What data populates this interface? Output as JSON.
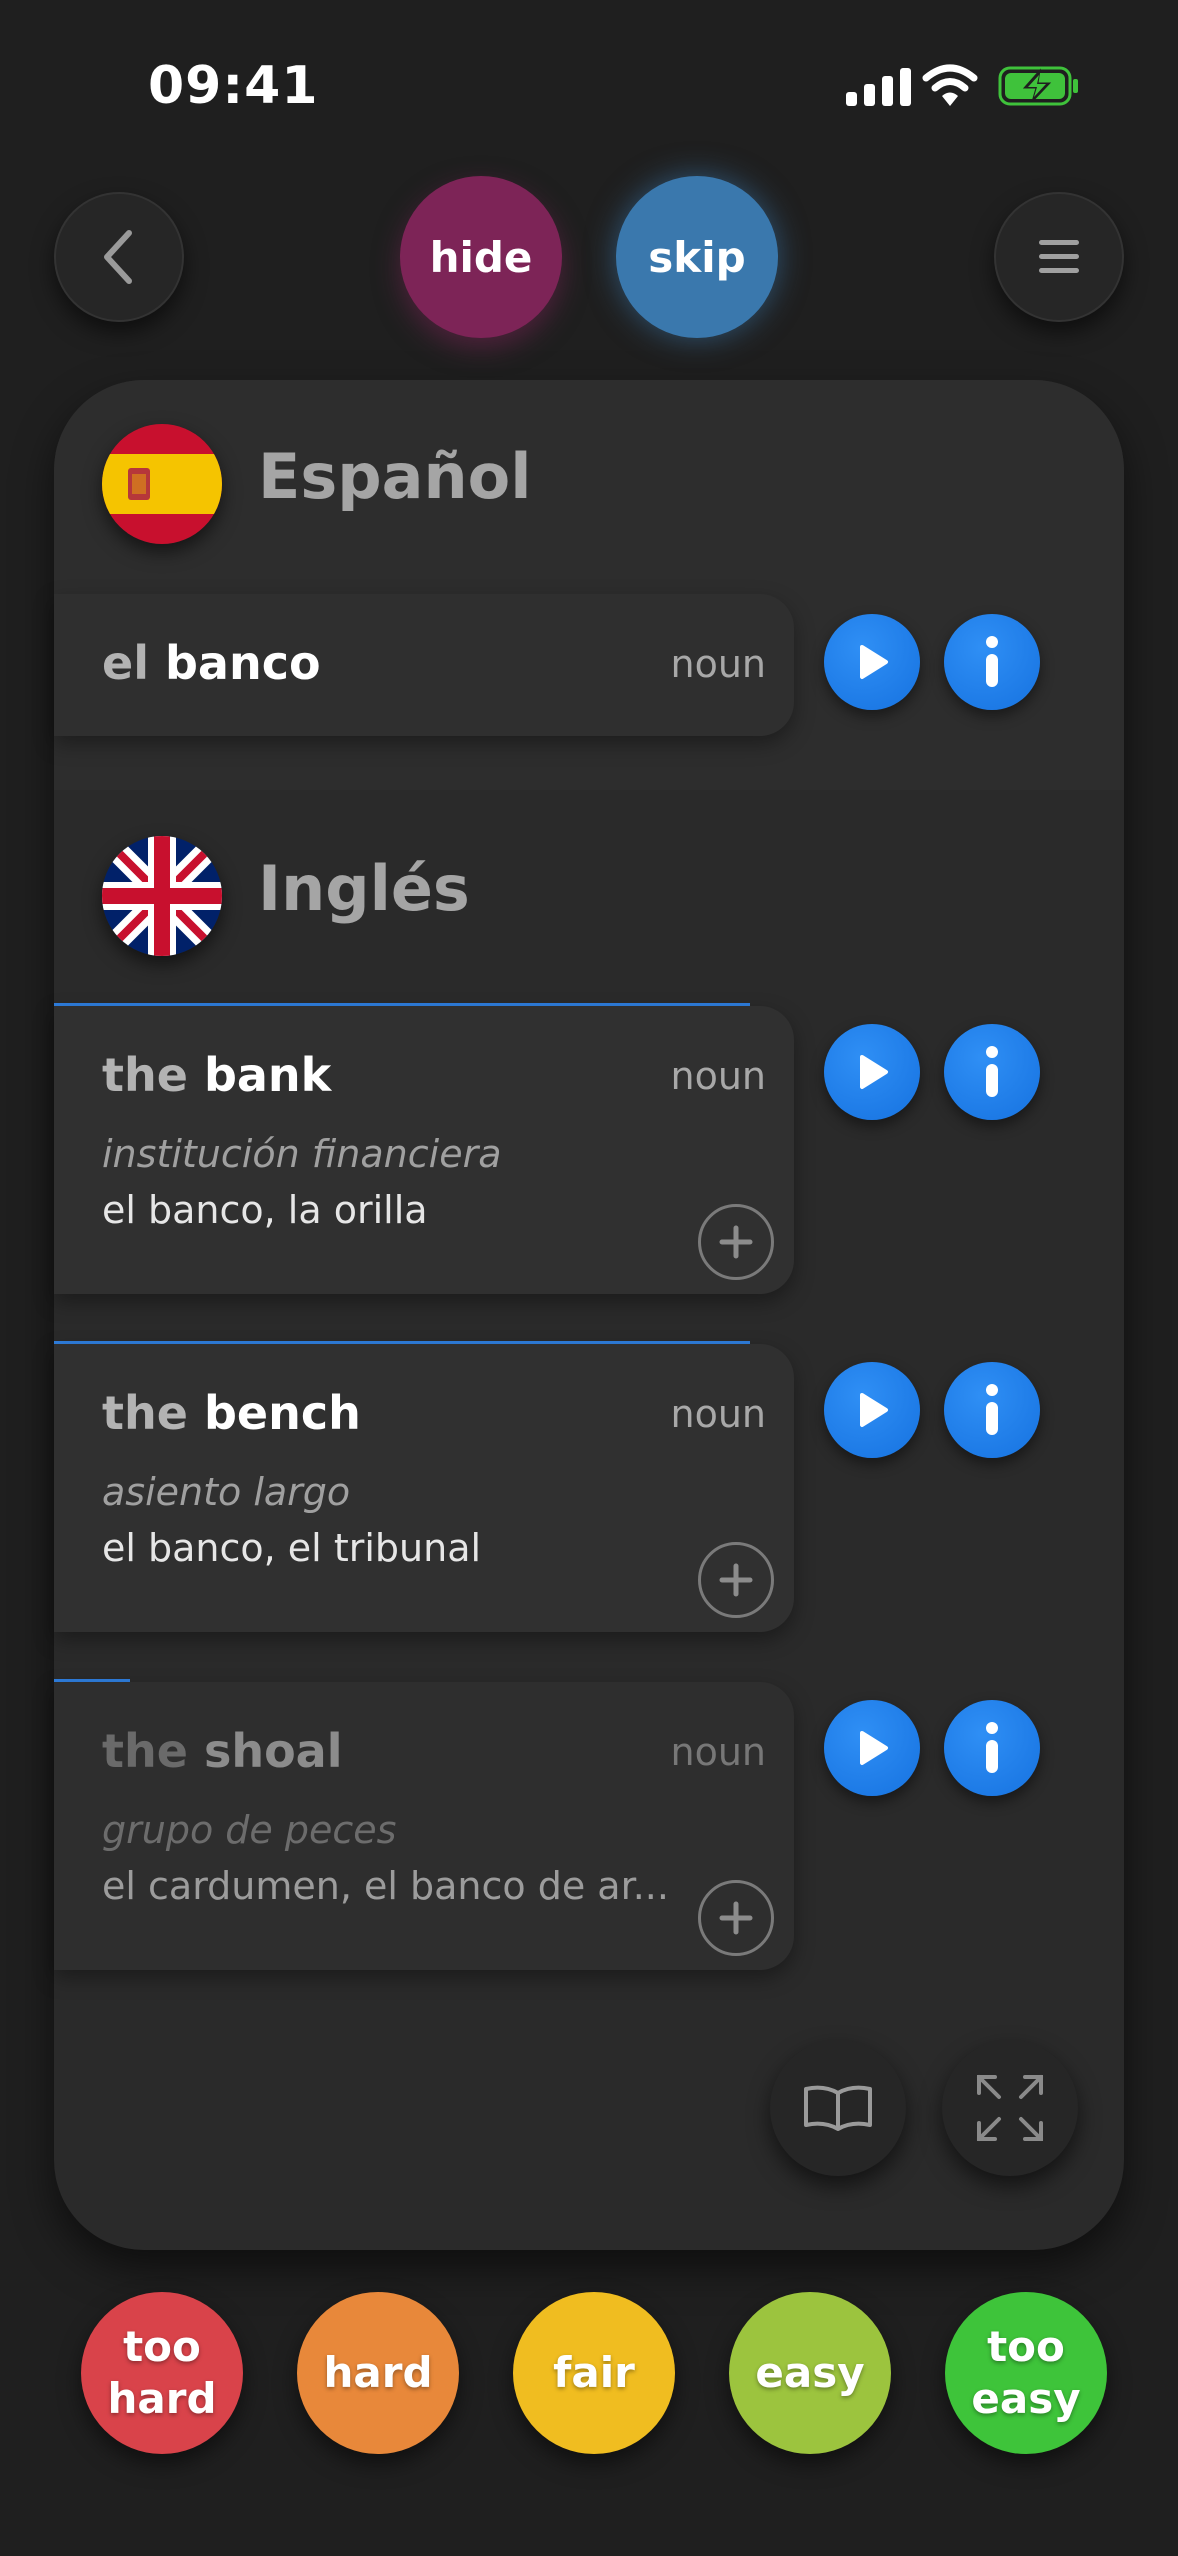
{
  "status_bar": {
    "time": "09:41"
  },
  "top_nav": {
    "back_icon": "chevron-left-icon",
    "hide_label": "hide",
    "skip_label": "skip",
    "menu_icon": "hamburger-menu-icon",
    "hide_color": "#7d2457",
    "skip_color": "#3a78ad"
  },
  "source": {
    "language": "Español",
    "flag": "spain-flag",
    "word": {
      "article": "el",
      "lemma": "banco",
      "pos": "noun"
    }
  },
  "target": {
    "language": "Inglés",
    "flag": "uk-flag",
    "entries": [
      {
        "article": "the",
        "lemma": "bank",
        "pos": "noun",
        "definition": "institución financiera",
        "translations": "el banco, la orilla",
        "progress": 0.85
      },
      {
        "article": "the",
        "lemma": "bench",
        "pos": "noun",
        "definition": "asiento largo",
        "translations": "el banco, el tribunal",
        "progress": 0.85
      },
      {
        "article": "the",
        "lemma": "shoal",
        "pos": "noun",
        "definition": "grupo de peces",
        "translations": "el cardumen, el banco de ar...",
        "progress": 0.1
      }
    ]
  },
  "card_tools": {
    "book_icon": "open-book-icon",
    "expand_icon": "expand-icon"
  },
  "rating": {
    "too_hard_1": "too",
    "too_hard_2": "hard",
    "hard": "hard",
    "fair": "fair",
    "easy": "easy",
    "too_easy_1": "too",
    "too_easy_2": "easy",
    "colors": {
      "too_hard": "#d9434a",
      "hard": "#e8883a",
      "fair": "#f0bd20",
      "easy": "#9cc43e",
      "too_easy": "#3ec43a"
    }
  }
}
